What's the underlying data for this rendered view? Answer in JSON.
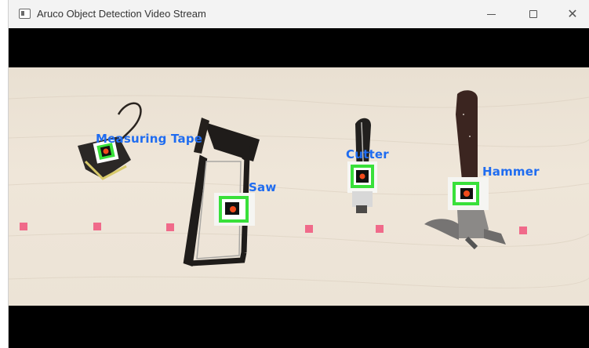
{
  "window": {
    "title": "Aruco Object Detection Video Stream",
    "icon": "app-window-icon",
    "controls": [
      "minimize-icon",
      "maximize-icon",
      "close-icon"
    ],
    "close_glyph": "✕"
  },
  "detections": {
    "measuring_tape": "Measuring Tape",
    "saw": "Saw",
    "cutter": "Cutter",
    "hammer": "Hammer"
  },
  "colors": {
    "label": "#1f6cf0",
    "marker_border": "#39e03a",
    "marker_dot": "#f24b1c",
    "floor_marks": "#f06a8a"
  }
}
